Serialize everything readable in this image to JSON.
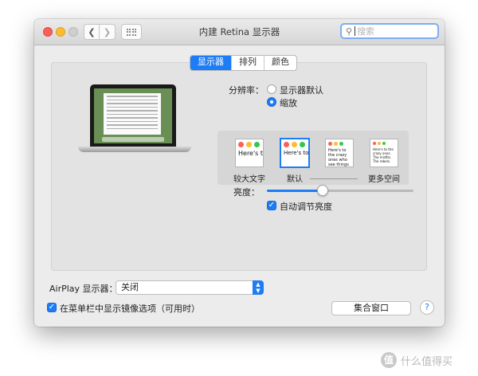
{
  "window": {
    "title": "内建 Retina 显示器"
  },
  "search": {
    "placeholder": "搜索"
  },
  "tabs": [
    {
      "label": "显示器",
      "active": true
    },
    {
      "label": "排列",
      "active": false
    },
    {
      "label": "颜色",
      "active": false
    }
  ],
  "resolution": {
    "label": "分辨率：",
    "options": [
      {
        "label": "显示器默认",
        "selected": false
      },
      {
        "label": "缩放",
        "selected": true
      }
    ]
  },
  "scaled_options": [
    {
      "label": "较大文字",
      "preview_text": "Here's to the troublemakers."
    },
    {
      "label": "默认",
      "preview_text": "Here's to the troublemakers. The ones who see"
    },
    {
      "label": "",
      "preview_text": "Here's to the crazy ones who see things differently. rules. And they"
    },
    {
      "label": "更多空间",
      "preview_text": "Here's to the crazy ones. The misfits. The rebels."
    }
  ],
  "brightness": {
    "label": "亮度：",
    "value": 0.38
  },
  "auto_brightness": {
    "label": "自动调节亮度",
    "checked": true
  },
  "airplay": {
    "label": "AirPlay 显示器：",
    "value": "关闭"
  },
  "mirror_option": {
    "label": "在菜单栏中显示镜像选项（可用时）",
    "checked": true
  },
  "gather_windows": {
    "label": "集合窗口"
  },
  "help": {
    "label": "?"
  },
  "watermark": {
    "badge": "值",
    "text": "什么值得买"
  },
  "colors": {
    "accent": "#1e7cf5",
    "window_bg": "#ececec",
    "panel_bg": "#e3e3e3"
  }
}
